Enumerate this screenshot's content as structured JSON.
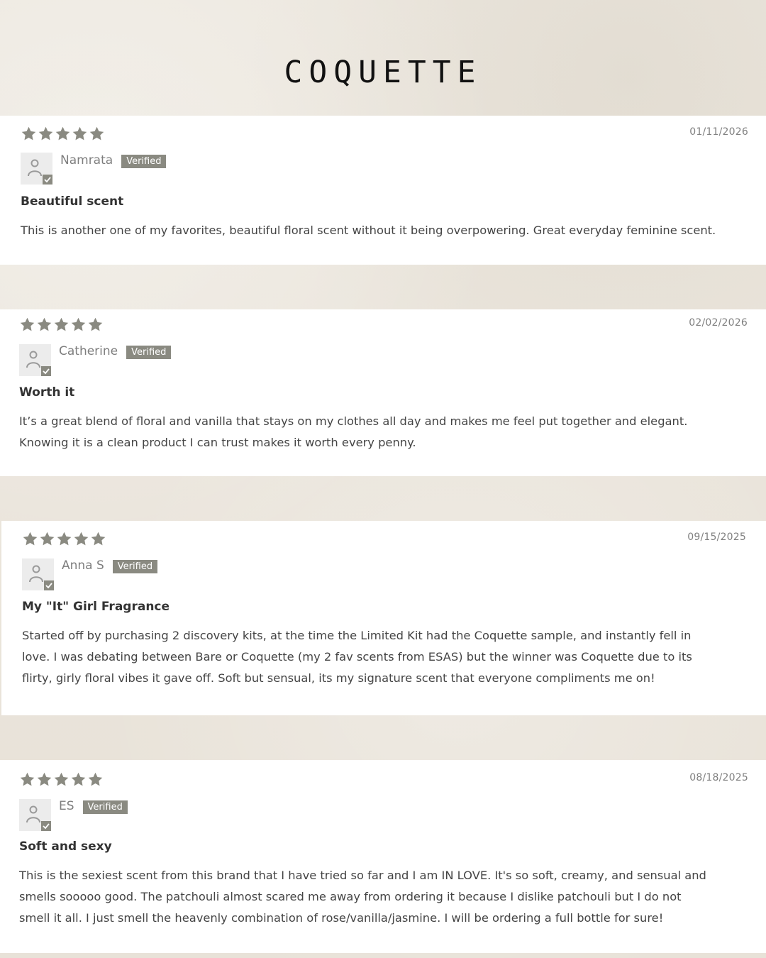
{
  "header": {
    "title": "COQUETTE"
  },
  "colors": {
    "page_background": "#ebe6dd",
    "card_background": "#ffffff",
    "star_color": "#8a8a81",
    "verified_badge": "#8a8a81",
    "title_text": "#111111"
  },
  "icons": {
    "rating_star": "star-icon",
    "avatar": "user-avatar-icon",
    "verified_check": "check-icon"
  },
  "reviews": [
    {
      "rating": 5,
      "rating_max": 5,
      "date": "01/11/2026",
      "author": "Namrata",
      "badge": "Verified",
      "title": "Beautiful scent",
      "body_lines": [
        "This is another one of my favorites, beautiful floral scent without it being overpowering. Great everyday feminine scent."
      ]
    },
    {
      "rating": 5,
      "rating_max": 5,
      "date": "02/02/2026",
      "author": "Catherine",
      "badge": "Verified",
      "title": "Worth it",
      "body_lines": [
        "It’s a great blend of floral and vanilla that stays on my clothes all day and makes me feel put together and elegant.",
        "Knowing it is a clean product I can trust makes it worth every penny."
      ]
    },
    {
      "rating": 5,
      "rating_max": 5,
      "date": "09/15/2025",
      "author": "Anna S",
      "badge": "Verified",
      "title": "My \"It\" Girl Fragrance",
      "body_lines": [
        "Started off by purchasing 2 discovery kits, at the time the Limited Kit had the Coquette sample, and instantly fell in",
        "love. I was debating between Bare or Coquette (my 2 fav scents from ESAS) but the winner was Coquette due to its",
        "flirty, girly floral vibes it gave off. Soft but sensual, its my signature scent that everyone compliments me on!"
      ]
    },
    {
      "rating": 5,
      "rating_max": 5,
      "date": "08/18/2025",
      "author": "ES",
      "badge": "Verified",
      "title": "Soft and sexy",
      "body_lines": [
        "This is the sexiest scent from this brand that I have tried so far and I am IN LOVE. It's so soft, creamy, and sensual and",
        "smells sooooo good. The patchouli almost scared me away from ordering it because I dislike patchouli but I do not",
        "smell it all. I just smell the heavenly combination of rose/vanilla/jasmine. I will be ordering a full bottle for sure!"
      ]
    }
  ]
}
